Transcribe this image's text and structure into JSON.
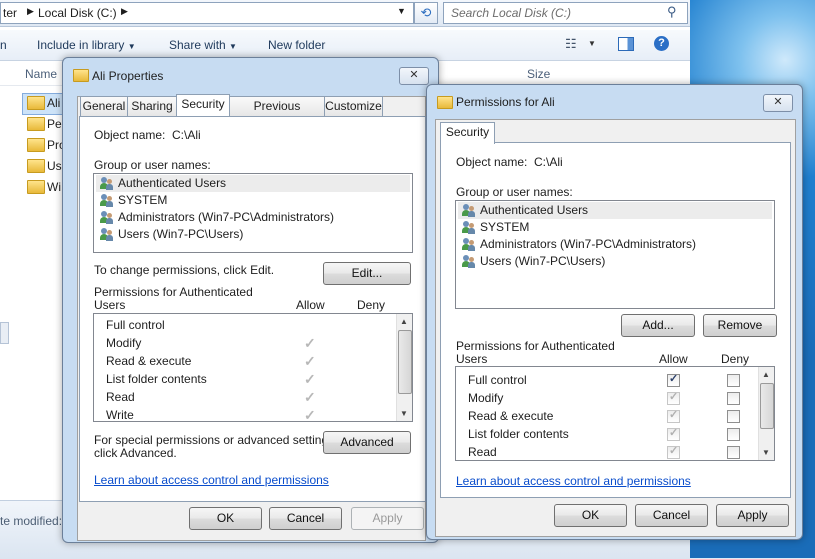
{
  "explorer": {
    "breadcrumb": {
      "part1": "ter",
      "part2": "Local Disk (C:)"
    },
    "search_placeholder": "Search Local Disk (C:)",
    "toolbar": {
      "organize": "n",
      "include": "Include in library",
      "share": "Share with",
      "newfolder": "New folder"
    },
    "columns": {
      "name": "Name",
      "size": "Size"
    },
    "items": [
      "Ali",
      "Per",
      "Pro",
      "Use",
      "Wi"
    ],
    "details": "te modified:"
  },
  "props": {
    "title": "Ali Properties",
    "close": "✕",
    "tabs": [
      "General",
      "Sharing",
      "Security",
      "Previous Versions",
      "Customize"
    ],
    "object_label": "Object name:",
    "object_value": "C:\\Ali",
    "group_label": "Group or user names:",
    "users": [
      "Authenticated Users",
      "SYSTEM",
      "Administrators (Win7-PC\\Administrators)",
      "Users (Win7-PC\\Users)"
    ],
    "change_text": "To change permissions, click Edit.",
    "edit_btn": "Edit...",
    "perm_for_1": "Permissions for Authenticated",
    "perm_for_2": "Users",
    "allow": "Allow",
    "deny": "Deny",
    "perms": [
      "Full control",
      "Modify",
      "Read & execute",
      "List folder contents",
      "Read",
      "Write"
    ],
    "special_1": "For special permissions or advanced settings,",
    "special_2": "click Advanced.",
    "advanced_btn": "Advanced",
    "link": "Learn about access control and permissions",
    "ok": "OK",
    "cancel": "Cancel",
    "apply": "Apply"
  },
  "perm": {
    "title": "Permissions for Ali",
    "close": "✕",
    "tab": "Security",
    "object_label": "Object name:",
    "object_value": "C:\\Ali",
    "group_label": "Group or user names:",
    "users": [
      "Authenticated Users",
      "SYSTEM",
      "Administrators (Win7-PC\\Administrators)",
      "Users (Win7-PC\\Users)"
    ],
    "add_btn": "Add...",
    "remove_btn": "Remove",
    "perm_for_1": "Permissions for Authenticated",
    "perm_for_2": "Users",
    "allow": "Allow",
    "deny": "Deny",
    "perms": [
      "Full control",
      "Modify",
      "Read & execute",
      "List folder contents",
      "Read"
    ],
    "link": "Learn about access control and permissions",
    "ok": "OK",
    "cancel": "Cancel",
    "apply": "Apply"
  }
}
